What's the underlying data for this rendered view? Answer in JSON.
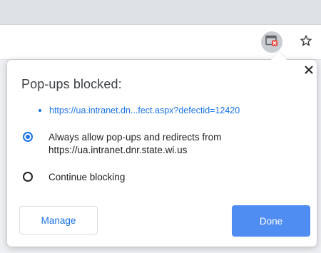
{
  "toolbar": {
    "popup_indicator_icon": "popup-blocked-icon",
    "star_icon": "star-icon"
  },
  "bubble": {
    "title": "Pop-ups blocked:",
    "close_icon": "close-icon",
    "blocked_url": "https://ua.intranet.dn...fect.aspx?defectid=12420",
    "options": [
      {
        "label": "Always allow pop-ups and redirects from https://ua.intranet.dnr.state.wi.us",
        "selected": true
      },
      {
        "label": "Continue blocking",
        "selected": false
      }
    ],
    "manage_label": "Manage",
    "done_label": "Done"
  },
  "colors": {
    "accent": "#1a73e8",
    "done_button": "#4f8df3",
    "indicator_badge": "#e8453c"
  }
}
